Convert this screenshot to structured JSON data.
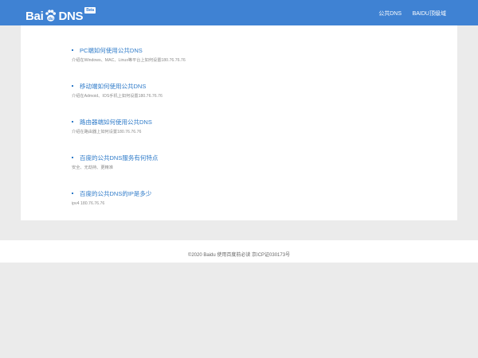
{
  "header": {
    "logo_text_left": "Bai",
    "logo_text_right": "DNS",
    "logo_badge": "Beta",
    "nav": [
      {
        "label": "公共DNS"
      },
      {
        "label": "BAIDU顶级域"
      }
    ],
    "colors": {
      "bar": "#3f82d3",
      "text": "#ffffff"
    }
  },
  "main": {
    "items": [
      {
        "title": "PC端如何使用公共DNS",
        "desc": "介绍在Windows、MAC、Linux等平台上如何设置180.76.76.76"
      },
      {
        "title": "移动端如何使用公共DNS",
        "desc": "介绍在Admoid、IOS手机上如何设置180.76.76.76"
      },
      {
        "title": "路由器端如何使用公共DNS",
        "desc": "介绍在路由器上如何设置180.76.76.76"
      },
      {
        "title": "百度的公共DNS服务有何特点",
        "desc": "安全、无劫持、更精准"
      },
      {
        "title": "百度的公共DNS的IP是多少",
        "desc": "ipv4 180.76.76.76"
      }
    ],
    "colors": {
      "link": "#2f7bc9",
      "desc": "#8a8a8a"
    }
  },
  "footer": {
    "copyright": "©2020 Baidu",
    "terms": "使用百度前必读",
    "icp": "京ICP证030173号"
  }
}
